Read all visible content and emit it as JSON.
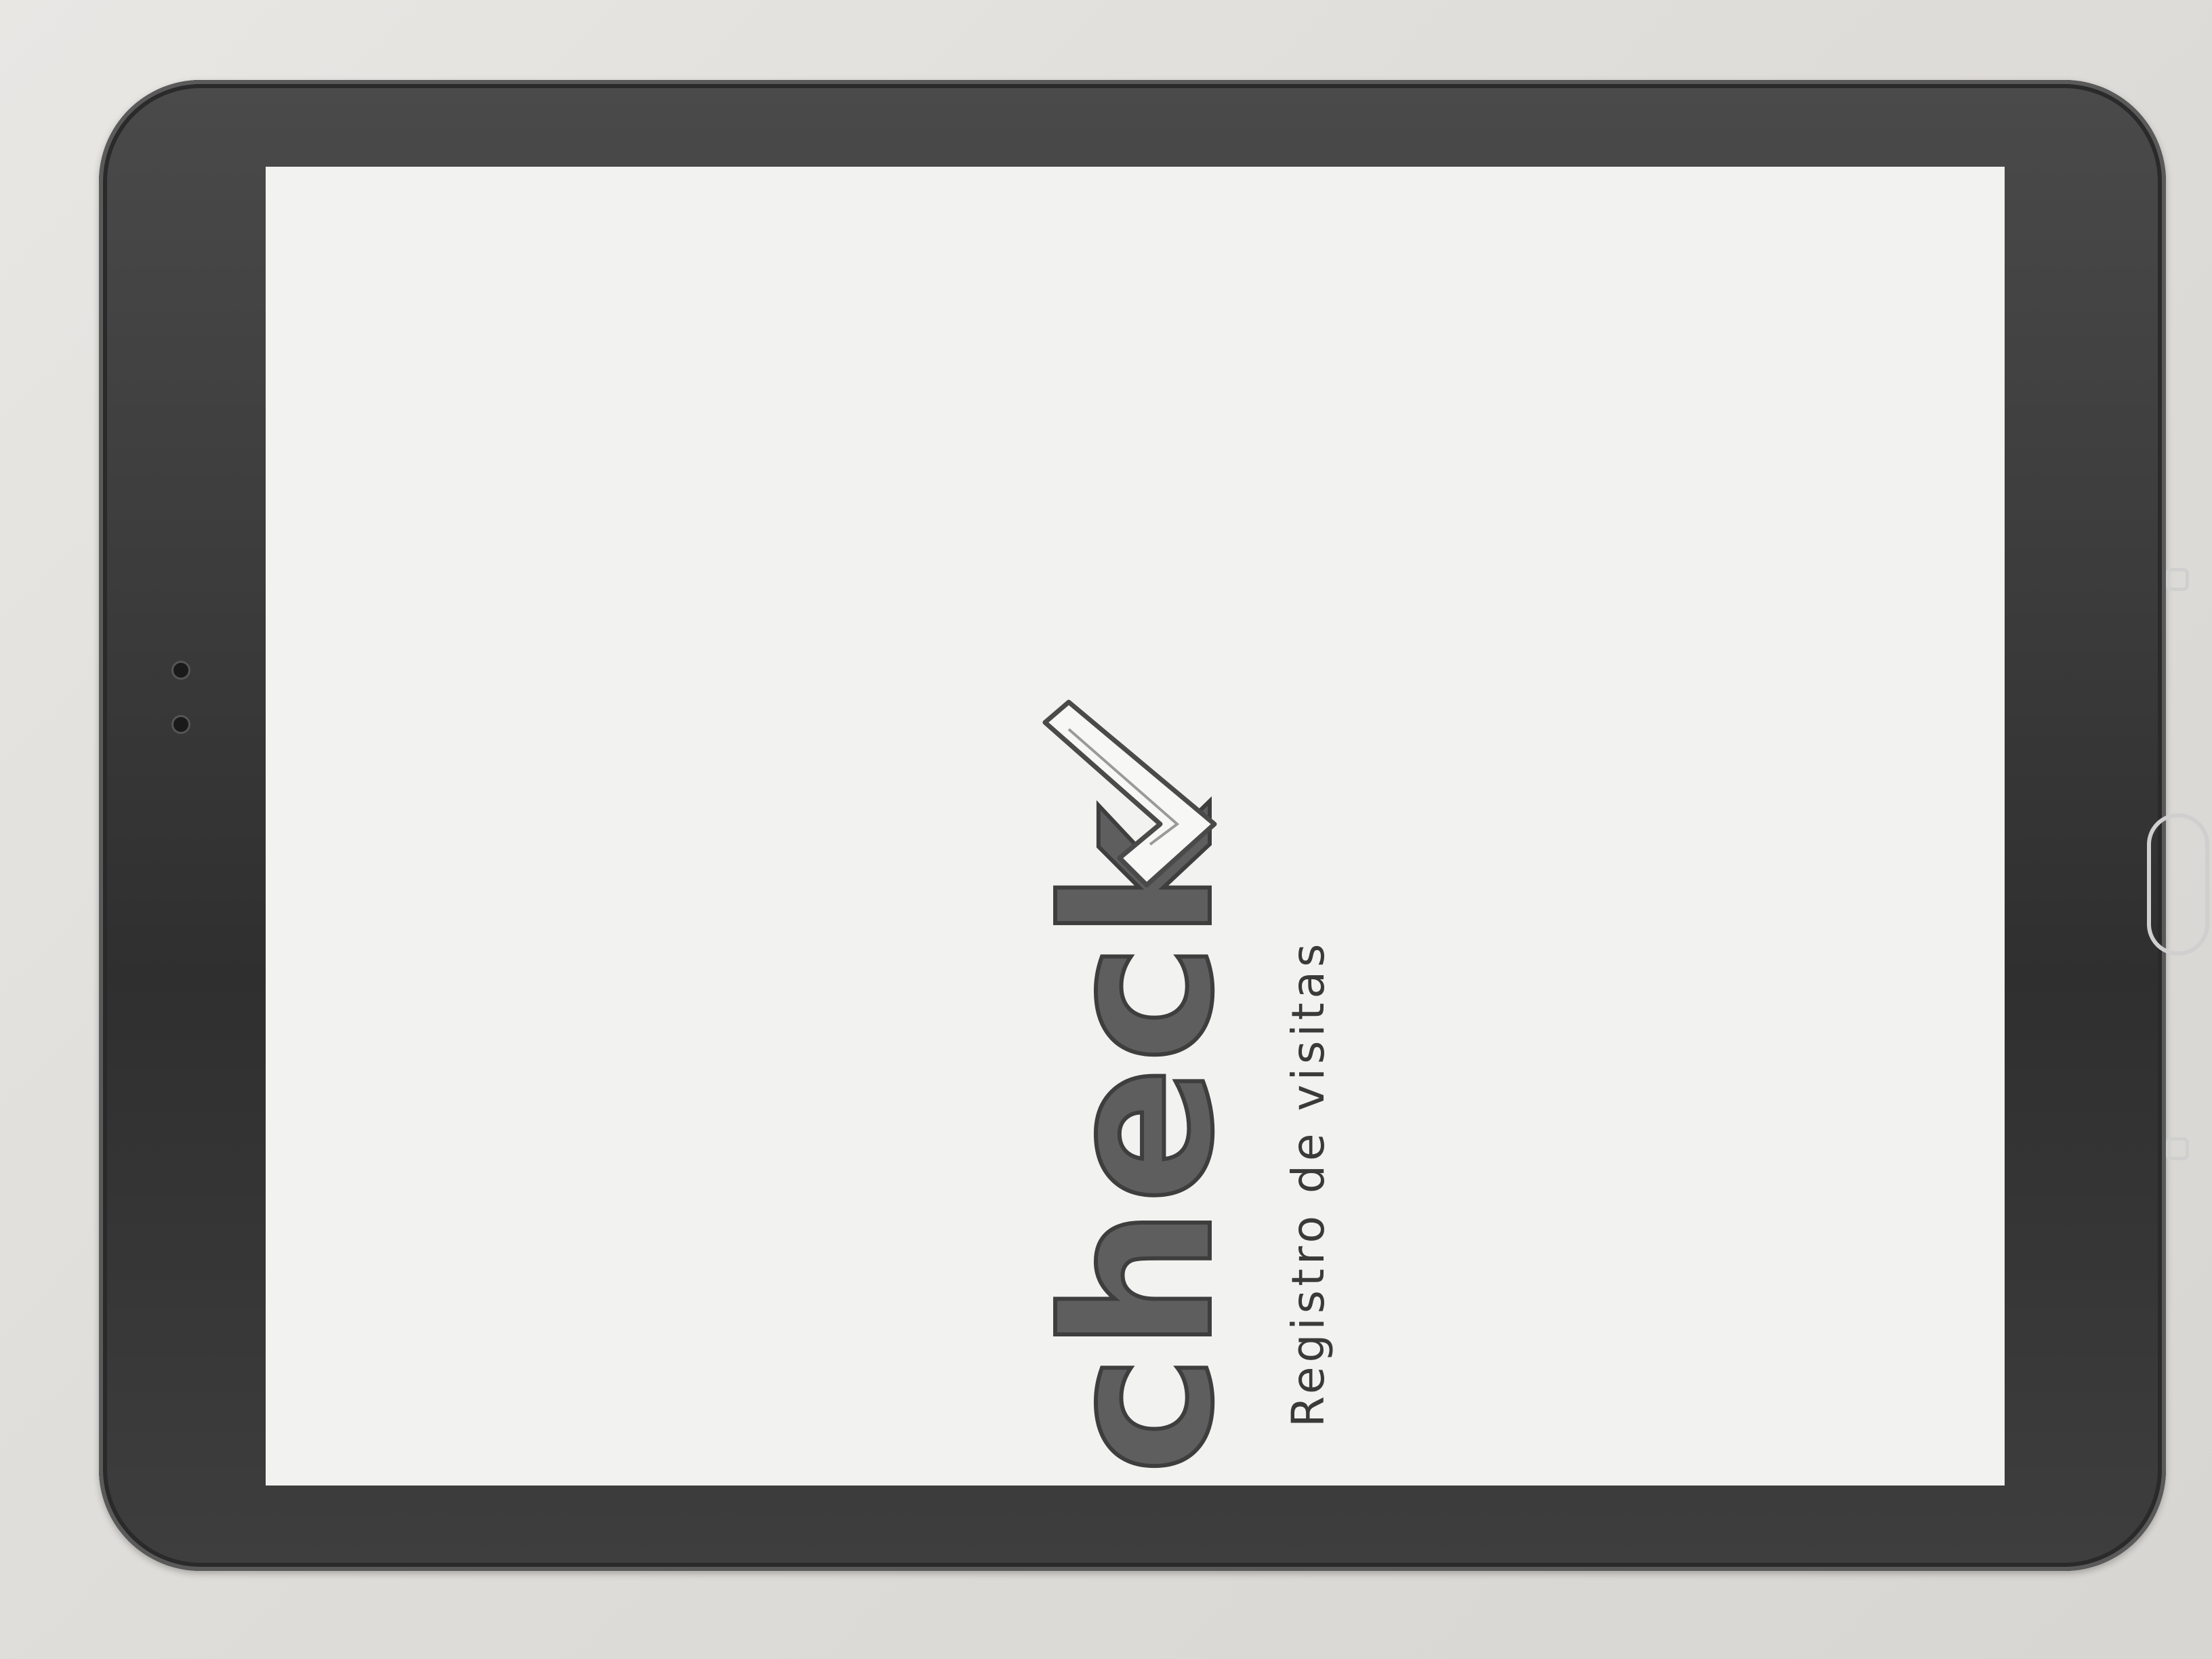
{
  "app": {
    "logo_text": "check",
    "subtitle": "Registro de visitas"
  },
  "device": {
    "frame_color": "#3b3b3b",
    "screen_color": "#f2f2f0",
    "ink_color": "#5e5e5e"
  },
  "icons": {
    "logo_mark": "checkmark-icon",
    "home": "home-button",
    "back": "back-key-icon",
    "recent": "recent-apps-key-icon"
  }
}
